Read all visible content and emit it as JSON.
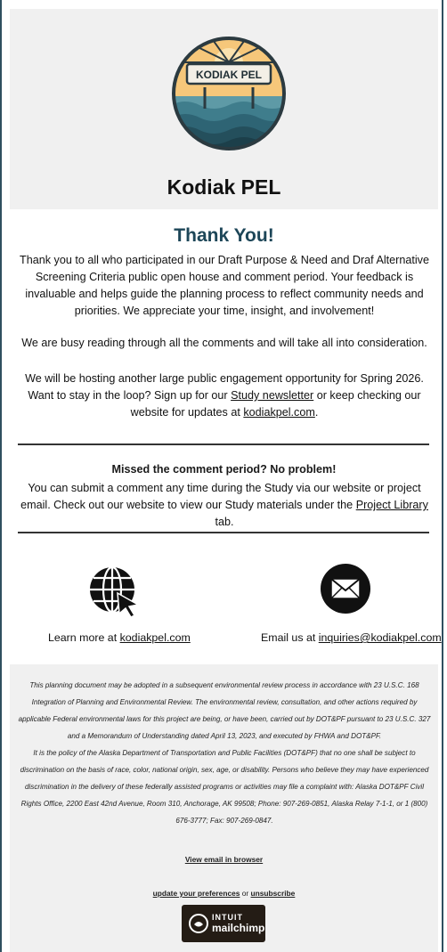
{
  "header": {
    "logo_text": "KODIAK PEL",
    "title": "Kodiak PEL"
  },
  "thanks": {
    "heading": "Thank You!",
    "para1": "Thank you to all who participated in our Draft Purpose & Need and Draf Alternative Screening Criteria public open house and comment period. Your feedback is invaluable and helps guide the planning process to reflect community needs and priorities. We appreciate your time, insight, and involvement!",
    "para2": "We are busy reading through all the comments and will take all into consideration.",
    "para3_a": "We will be hosting another large public engagement opportunity for Spring 2026. Want to stay in the loop? Sign up for our ",
    "para3_link1": "Study newsletter",
    "para3_b": " or keep checking our website for updates at ",
    "para3_link2": "kodiakpel.com",
    "para3_c": "."
  },
  "missed": {
    "heading": "Missed the comment period? No problem!",
    "body_a": "You can submit a comment any time during the Study via our website or project email. Check out our website to view our Study materials under the ",
    "body_link": "Project Library",
    "body_b": " tab."
  },
  "contact": {
    "globe_icon": "globe-cursor-icon",
    "mail_icon": "envelope-icon",
    "learn_prefix": "Learn more at ",
    "learn_link": "kodiakpel.com",
    "email_prefix": "Email us at ",
    "email_link": "inquiries@kodiakpel.com"
  },
  "footer": {
    "legal1": "This planning document may be adopted in a subsequent environmental review process in accordance with 23 U.S.C. 168 Integration of Planning and Environmental Review. The environmental review, consultation, and other actions required by applicable Federal environmental laws for this project are being, or have been, carried out by DOT&PF pursuant to 23 U.S.C. 327 and a Memorandum of Understanding dated April 13, 2023, and executed by FHWA and DOT&PF.",
    "legal2": "It is the policy of the Alaska Department of Transportation and Public Facilities (DOT&PF) that no one shall be subject to discrimination on the basis of race, color, national origin, sex, age, or disability. Persons who believe they may have experienced discrimination in the delivery of these federally assisted programs or activities may file a complaint with: Alaska DOT&PF Civil Rights Office, 2200 East 42nd Avenue, Room 310, Anchorage, AK 99508; Phone: 907-269-0851, Alaska Relay 7-1-1, or 1 (800) 676-3777; Fax: 907-269-0847.",
    "view_browser": "View email in browser",
    "prefs_link": "update your preferences",
    "prefs_or": " or ",
    "unsubscribe": "unsubscribe",
    "badge_line1": "INTUIT",
    "badge_line2": "mailchimp"
  },
  "colors": {
    "heading": "#1d4658",
    "frame": "#2f4f5f",
    "panel": "#f0f0f0",
    "logo_sky": "#f6c77a",
    "logo_water": "#3f7d8c"
  }
}
